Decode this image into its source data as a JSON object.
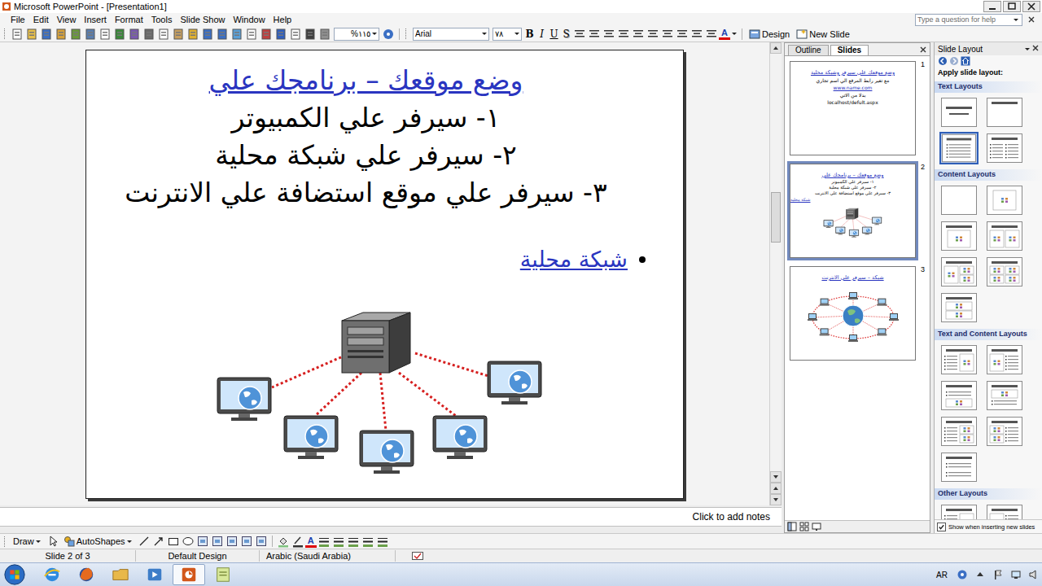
{
  "window": {
    "title": "Microsoft PowerPoint - [Presentation1]"
  },
  "menu": [
    "File",
    "Edit",
    "View",
    "Insert",
    "Format",
    "Tools",
    "Slide Show",
    "Window",
    "Help"
  ],
  "help_box": {
    "placeholder": "Type a question for help"
  },
  "toolbar": {
    "zoom": "%١١٥",
    "font": "Arial",
    "font_size": "٧٨",
    "format_buttons": [
      {
        "label": "B",
        "kind": "bold"
      },
      {
        "label": "I",
        "kind": "italic"
      },
      {
        "label": "U",
        "kind": "underline"
      },
      {
        "label": "S",
        "kind": "shadow"
      }
    ],
    "font_color": "A",
    "design": "Design",
    "new_slide": "New Slide"
  },
  "slide": {
    "title": "وضع موقعك – برنامجك علي",
    "lines": [
      "١- سيرفر علي الكمبيوتر",
      "٢- سيرفر علي شبكة محلية",
      "٣- سيرفر علي موقع استضافة علي الانترنت"
    ],
    "bullet": "شبكة محلية",
    "diagram": "lan"
  },
  "pane_tabs": [
    {
      "label": "Outline",
      "selected": false
    },
    {
      "label": "Slides",
      "selected": true
    }
  ],
  "thumbnails": [
    {
      "number": "1",
      "selected": false,
      "kind": "text",
      "title": "وضع موقعك علي سيرفر وشبكة محلية",
      "lines": [
        {
          "text": "مع تغير رابط المرفع الي اسم تجاري",
          "link": false
        },
        {
          "text": "www.name.com",
          "link": true
        },
        {
          "text": "بدلا من الاتي",
          "link": false
        },
        {
          "text": "localhost/defult.aspx",
          "link": false
        }
      ]
    },
    {
      "number": "2",
      "selected": true,
      "kind": "lan",
      "title": "وضع موقعك – برنامجك علي",
      "lines": [
        {
          "text": "١- سيرفر علي الكمبيوتر",
          "link": false
        },
        {
          "text": "٢- سيرفر علي شبكة محلية",
          "link": false
        },
        {
          "text": "٣- سيرفر علي موقع استضافة علي الانترنت",
          "link": false
        }
      ],
      "bullet": "شبكة محلية"
    },
    {
      "number": "3",
      "selected": false,
      "kind": "internet",
      "title": "شبكة – سيرفر علي الانترنت",
      "lines": []
    }
  ],
  "notes": {
    "placeholder": "Click to add notes"
  },
  "task_pane": {
    "title": "Slide Layout",
    "apply_label": "Apply slide layout:",
    "sections": [
      {
        "title": "Text Layouts",
        "layouts": [
          {
            "kind": "title-slide",
            "selected": false
          },
          {
            "kind": "title-only",
            "selected": false
          },
          {
            "kind": "title-text",
            "selected": true
          },
          {
            "kind": "two-text",
            "selected": false
          }
        ]
      },
      {
        "title": "Content Layouts",
        "layouts": [
          {
            "kind": "blank",
            "selected": false
          },
          {
            "kind": "content",
            "selected": false
          },
          {
            "kind": "title-content",
            "selected": false
          },
          {
            "kind": "two-content",
            "selected": false
          },
          {
            "kind": "content-stack",
            "selected": false
          },
          {
            "kind": "four-content",
            "selected": false
          },
          {
            "kind": "content-over",
            "selected": false
          }
        ]
      },
      {
        "title": "Text and Content Layouts",
        "layouts": [
          {
            "kind": "text-content",
            "selected": false
          },
          {
            "kind": "content-text",
            "selected": false
          },
          {
            "kind": "text-over-content",
            "selected": false
          },
          {
            "kind": "content-over-text",
            "selected": false
          },
          {
            "kind": "text-two-content",
            "selected": false
          },
          {
            "kind": "two-content-text",
            "selected": false
          },
          {
            "kind": "text-stack",
            "selected": false
          }
        ]
      },
      {
        "title": "Other Layouts",
        "layouts": [
          {
            "kind": "text-content",
            "selected": false
          },
          {
            "kind": "content-text",
            "selected": false
          }
        ]
      }
    ],
    "show_checkbox": {
      "label": "Show when inserting new slides",
      "checked": true
    }
  },
  "draw_toolbar": {
    "draw": "Draw",
    "autoshapes": "AutoShapes",
    "font_color": "A"
  },
  "status_bar": [
    "Slide 2 of 3",
    "Default Design",
    "Arabic (Saudi Arabia)"
  ],
  "taskbar": {
    "language": "AR",
    "apps": [
      {
        "kind": "ie",
        "selected": false
      },
      {
        "kind": "firefox",
        "selected": false
      },
      {
        "kind": "folder",
        "selected": false
      },
      {
        "kind": "media",
        "selected": false
      },
      {
        "kind": "powerpoint",
        "selected": true
      },
      {
        "kind": "notes",
        "selected": false
      }
    ]
  }
}
